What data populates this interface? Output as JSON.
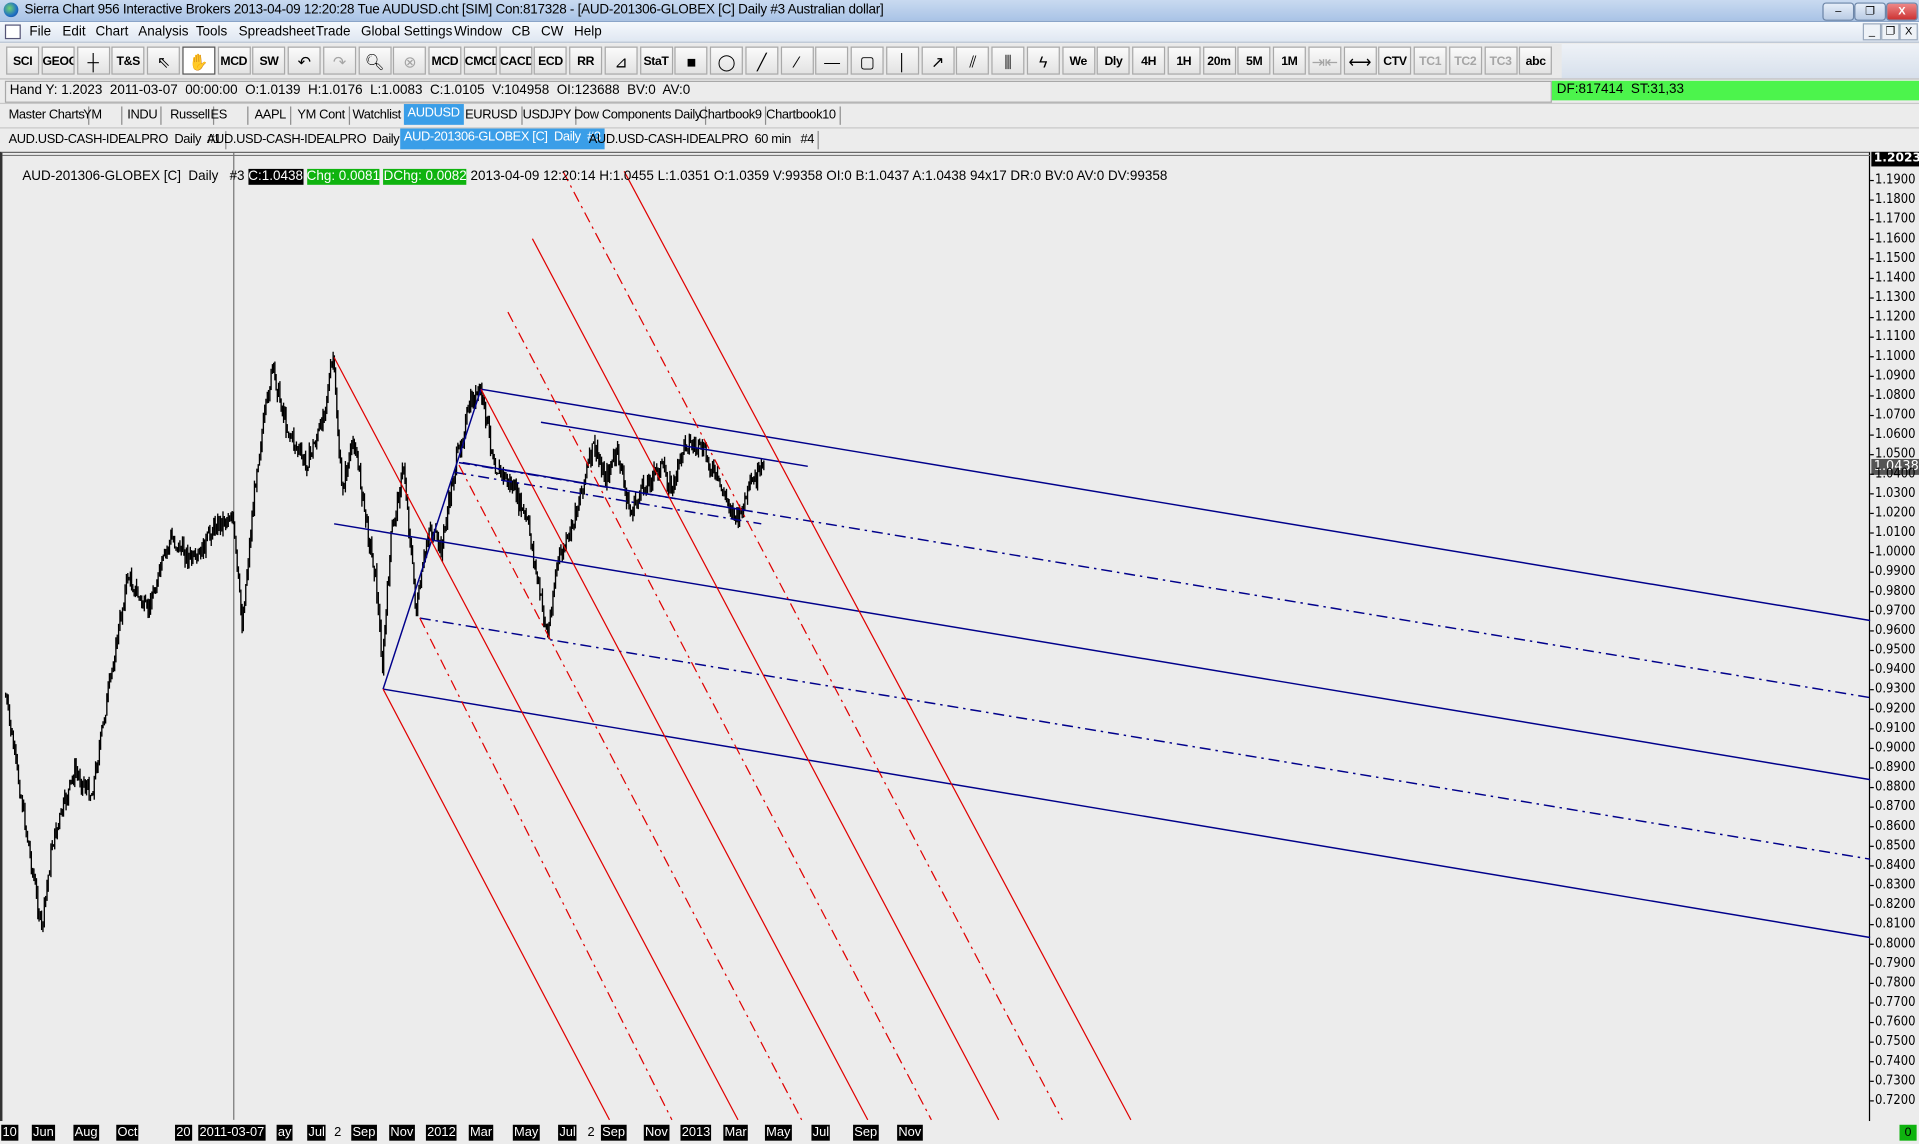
{
  "title_bar": {
    "title": "Sierra Chart 956 Interactive Brokers 2013-04-09  12:20:28 Tue  AUDUSD.cht [SIM] Con:817328 - [AUD-201306-GLOBEX [C]  Daily  #3  Australian dollar]",
    "controls": [
      "–",
      "❐",
      "X"
    ],
    "mdi_controls": [
      "_",
      "❐",
      "X"
    ]
  },
  "menu": [
    "File",
    "Edit",
    "Chart",
    "Analysis",
    "Tools",
    "Spreadsheet",
    "Trade",
    "Global Settings",
    "Window",
    "CB",
    "CW",
    "Help"
  ],
  "toolbar": [
    {
      "label": "SCI"
    },
    {
      "label": "GEOC"
    },
    {
      "label": "",
      "icon": "crosshair-icon"
    },
    {
      "label": "T&S"
    },
    {
      "label": "",
      "icon": "pointer-icon"
    },
    {
      "label": "",
      "icon": "hand-pan-icon",
      "active": true
    },
    {
      "label": "MCD"
    },
    {
      "label": "SW"
    },
    {
      "label": "",
      "icon": "undo-icon"
    },
    {
      "label": "",
      "icon": "redo-icon",
      "disabled": true
    },
    {
      "label": "",
      "icon": "zoom-in-icon"
    },
    {
      "label": "",
      "icon": "zoom-reset-icon",
      "disabled": true
    },
    {
      "label": "MCD"
    },
    {
      "label": "CMCD"
    },
    {
      "label": "CACD"
    },
    {
      "label": "ECD"
    },
    {
      "label": "RR"
    },
    {
      "label": "",
      "icon": "calculator-ruler-icon"
    },
    {
      "label": "StaT"
    },
    {
      "label": "",
      "icon": "stop-square-icon"
    },
    {
      "label": "",
      "icon": "ellipse-icon"
    },
    {
      "label": "",
      "icon": "line-icon"
    },
    {
      "label": "",
      "icon": "ray-icon"
    },
    {
      "label": "",
      "icon": "horizontal-line-icon"
    },
    {
      "label": "",
      "icon": "rectangle-icon"
    },
    {
      "label": "",
      "icon": "vertical-line-icon"
    },
    {
      "label": "",
      "icon": "arrow-icon"
    },
    {
      "label": "",
      "icon": "fib-retracement-icon"
    },
    {
      "label": "",
      "icon": "fib-extension-icon"
    },
    {
      "label": "",
      "icon": "pitchfork-icon"
    },
    {
      "label": "We"
    },
    {
      "label": "Dly"
    },
    {
      "label": "4H"
    },
    {
      "label": "1H"
    },
    {
      "label": "20m"
    },
    {
      "label": "5M"
    },
    {
      "label": "1M"
    },
    {
      "label": "",
      "icon": "compress-icon",
      "disabled": true
    },
    {
      "label": "",
      "icon": "expand-icon"
    },
    {
      "label": "CTV"
    },
    {
      "label": "TC1",
      "disabled": true
    },
    {
      "label": "TC2",
      "disabled": true
    },
    {
      "label": "TC3",
      "disabled": true
    },
    {
      "label": "abc"
    }
  ],
  "info_line": {
    "text": "Hand Y: 1.2023  2011-03-07  00:00:00  O:1.0139  H:1.0176  L:1.0083  C:1.0105  V:104958  OI:123688  BV:0  AV:0",
    "status": "DF:817414  ST:31,33",
    "status_color": "#4cf44c"
  },
  "chartbook_tabs": [
    {
      "label": "Master Charts"
    },
    {
      "label": "YM     "
    },
    {
      "label": "INDU"
    },
    {
      "label": "Russell"
    },
    {
      "label": "ES     "
    },
    {
      "label": "AAPL"
    },
    {
      "label": "YM Cont"
    },
    {
      "label": "Watchlist"
    },
    {
      "label": "AUDUSD",
      "active": true
    },
    {
      "label": "EURUSD"
    },
    {
      "label": "USDJPY"
    },
    {
      "label": "Dow Components Daily"
    },
    {
      "label": "Chartbook9"
    },
    {
      "label": "Chartbook10"
    }
  ],
  "chart_tabs": [
    {
      "label": "AUD.USD-CASH-IDEALPRO  Daily  #1"
    },
    {
      "label": "AUD.USD-CASH-IDEALPRO  Daily  #2"
    },
    {
      "label": "AUD-201306-GLOBEX [C]  Daily  #3",
      "active": true
    },
    {
      "label": "AUD.USD-CASH-IDEALPRO  60 min   #4"
    }
  ],
  "chart_header": {
    "symbol": "AUD-201306-GLOBEX [C]  Daily   #3 ",
    "close": "C:1.0438",
    "chg": "Chg: 0.0081",
    "dchg": "DChg: 0.0082",
    "details": " 2013-04-09 12:20:14 H:1.0455 L:1.0351 O:1.0359 V:99358 OI:0 B:1.0437 A:1.0438 94x17 DR:0 BV:0 AV:0 DV:99358"
  },
  "chart_data": {
    "type": "ohlc",
    "x": [
      "2010-04-13",
      "2010-06-04",
      "2010-06-19",
      "2010-07-21",
      "2010-08-15",
      "2010-09-10",
      "2010-10-06",
      "2010-11-03",
      "2010-12-07",
      "2011-01-12",
      "2011-02-08",
      "2011-03-04",
      "2011-03-18",
      "2011-04-09",
      "2011-05-01",
      "2011-05-22",
      "2011-06-18",
      "2011-07-09",
      "2011-07-27",
      "2011-08-09",
      "2011-08-27",
      "2011-09-15",
      "2011-09-27",
      "2011-10-07",
      "2011-10-19",
      "2011-11-07",
      "2011-11-25",
      "2011-12-13",
      "2011-12-30",
      "2012-01-20",
      "2012-02-12",
      "2012-02-26",
      "2012-03-17",
      "2012-04-13",
      "2012-05-04",
      "2012-05-18",
      "2012-05-31",
      "2012-06-14",
      "2012-07-01",
      "2012-07-19",
      "2012-08-06",
      "2012-08-23",
      "2012-09-10",
      "2012-09-28",
      "2012-10-15",
      "2012-11-11",
      "2012-11-28",
      "2012-12-16",
      "2013-01-12",
      "2013-02-07",
      "2013-03-01",
      "2013-03-16",
      "2013-04-09"
    ],
    "y": [
      0.926,
      0.807,
      0.851,
      0.888,
      0.876,
      0.932,
      0.988,
      0.969,
      1.007,
      0.994,
      1.013,
      1.019,
      0.963,
      1.044,
      1.094,
      1.063,
      1.044,
      1.063,
      1.099,
      1.032,
      1.057,
      1.013,
      0.988,
      0.941,
      1.007,
      1.044,
      0.969,
      1.013,
      1.001,
      1.044,
      1.076,
      1.082,
      1.044,
      1.032,
      1.013,
      0.982,
      0.957,
      0.994,
      1.007,
      1.032,
      1.054,
      1.038,
      1.051,
      1.019,
      1.032,
      1.044,
      1.032,
      1.057,
      1.051,
      1.032,
      1.016,
      1.032,
      1.0438
    ],
    "ylim": [
      0.71,
      1.2023
    ],
    "y_ticks": [
      "1.1900",
      "1.1800",
      "1.1700",
      "1.1600",
      "1.1500",
      "1.1400",
      "1.1300",
      "1.1200",
      "1.1100",
      "1.1000",
      "1.0900",
      "1.0800",
      "1.0700",
      "1.0600",
      "1.0500",
      "1.0400",
      "1.0300",
      "1.0200",
      "1.0100",
      "1.0000",
      "0.9900",
      "0.9800",
      "0.9700",
      "0.9600",
      "0.9500",
      "0.9400",
      "0.9300",
      "0.9200",
      "0.9100",
      "0.9000",
      "0.8900",
      "0.8800",
      "0.8700",
      "0.8600",
      "0.8500",
      "0.8400",
      "0.8300",
      "0.8200",
      "0.8100",
      "0.8000",
      "0.7900",
      "0.7800",
      "0.7700",
      "0.7600",
      "0.7500",
      "0.7400",
      "0.7300",
      "0.7200"
    ],
    "x_ticks": [
      "10",
      "Jun",
      "Aug",
      "Oct",
      "20",
      "2011-03-07",
      "ay",
      "Jul",
      "2",
      "Sep",
      "Nov",
      "2012",
      "Mar",
      "May",
      "Jul",
      "2",
      "Sep",
      "Nov",
      "2013",
      "Mar",
      "May",
      "Jul",
      "Sep",
      "Nov"
    ],
    "crosshair_price": "1.2023",
    "last_price": "1.0438",
    "bottom_right_value": "0",
    "bar_color": "#000000",
    "pitchfork_colors": {
      "blue": "#00008b",
      "red": "#e00000"
    },
    "grid": false
  }
}
